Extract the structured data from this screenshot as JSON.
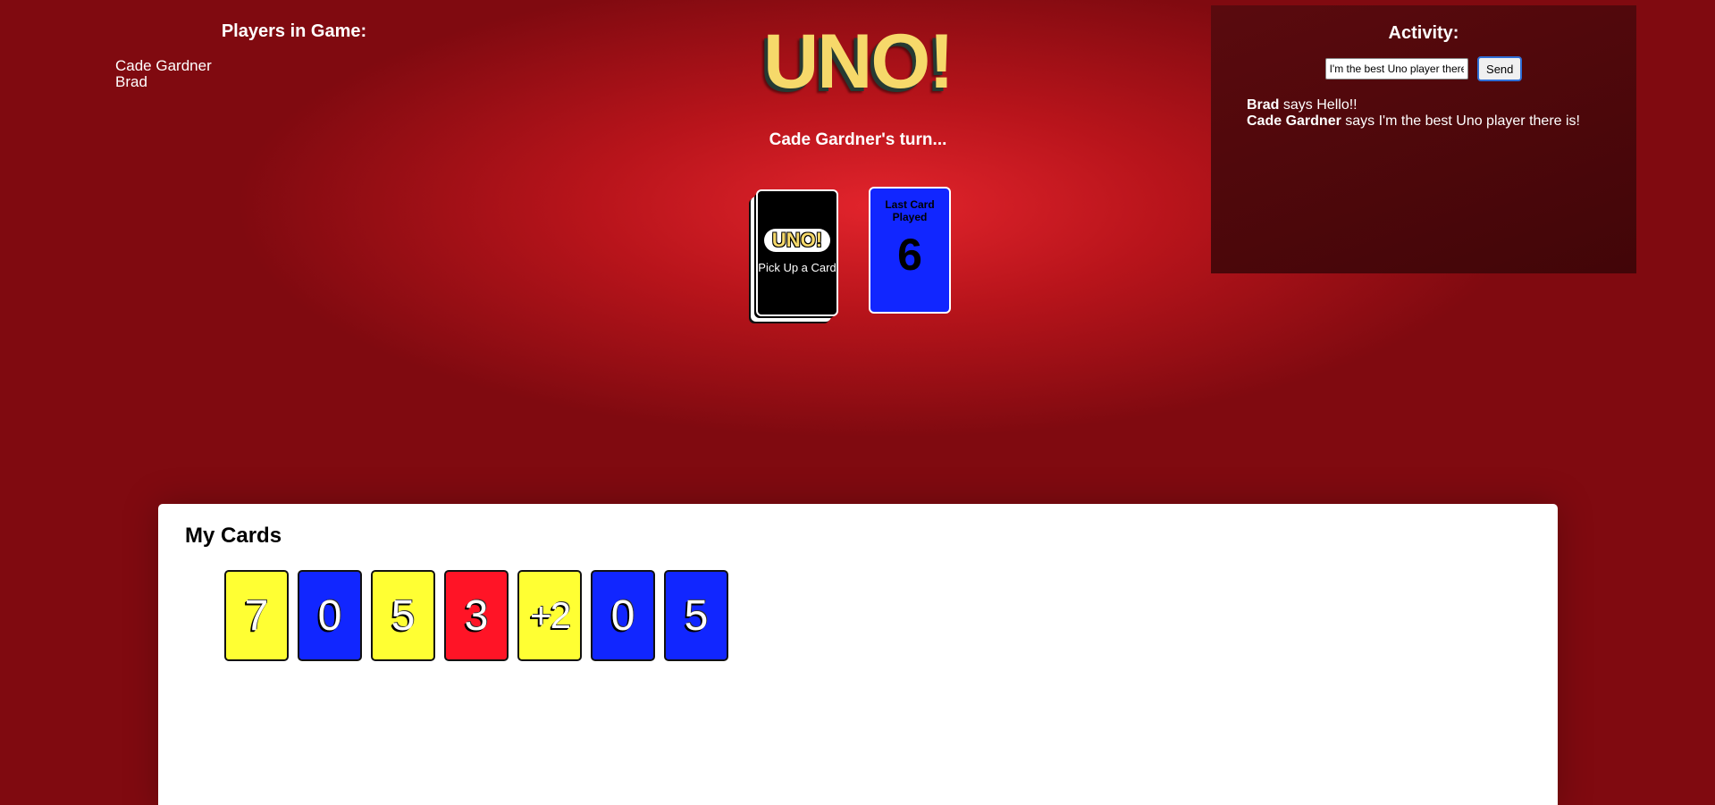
{
  "players": {
    "title": "Players in Game:",
    "names": [
      "Cade Gardner",
      "Brad"
    ]
  },
  "logo": "UNO!",
  "turn_text": "Cade Gardner's turn...",
  "deck": {
    "logo": "UNO!",
    "label": "Pick Up a Card"
  },
  "last_card": {
    "label": "Last Card Played",
    "value": "6",
    "color": "#1126ff"
  },
  "activity": {
    "title": "Activity:",
    "input_value": "I'm the best Uno player there is!",
    "send_label": "Send",
    "messages": [
      {
        "author": "Brad",
        "text": "says Hello!!"
      },
      {
        "author": "Cade Gardner",
        "text": "says I'm the best Uno player there is!"
      }
    ]
  },
  "my_cards": {
    "title": "My Cards",
    "cards": [
      {
        "value": "7",
        "color": "#ffff33"
      },
      {
        "value": "0",
        "color": "#1126ff"
      },
      {
        "value": "5",
        "color": "#ffff33"
      },
      {
        "value": "3",
        "color": "#ff1426"
      },
      {
        "value": "+2",
        "color": "#ffff33"
      },
      {
        "value": "0",
        "color": "#1126ff"
      },
      {
        "value": "5",
        "color": "#1126ff"
      }
    ]
  }
}
